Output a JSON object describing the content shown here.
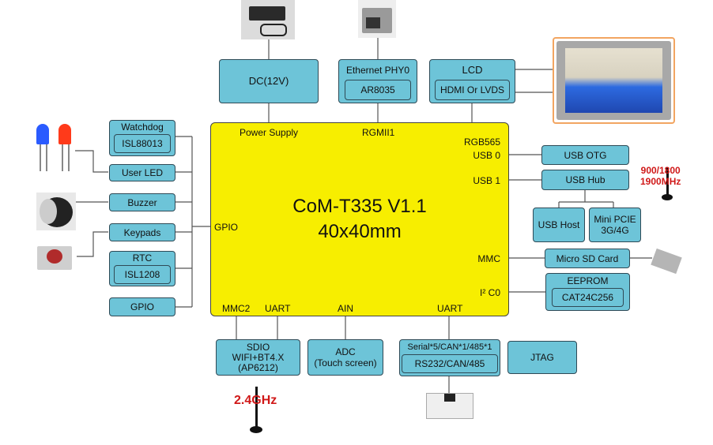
{
  "cpu": {
    "title": "CoM-T335 V1.1",
    "size": "40x40mm",
    "pins": {
      "power_supply": "Power Supply",
      "rgmii1": "RGMII1",
      "rgb565": "RGB565",
      "usb0": "USB 0",
      "usb1": "USB 1",
      "gpio": "GPIO",
      "mmc": "MMC",
      "i2c0": "I² C0",
      "mmc2": "MMC2",
      "uart_left": "UART",
      "ain": "AIN",
      "uart_right": "UART"
    }
  },
  "top": {
    "dc": "DC(12V)",
    "ethernet": {
      "title": "Ethernet PHY0",
      "chip": "AR8035"
    },
    "lcd": {
      "title": "LCD",
      "iface": "HDMI Or LVDS"
    }
  },
  "left": {
    "watchdog": {
      "title": "Watchdog",
      "chip": "ISL88013"
    },
    "user_led": "User LED",
    "buzzer": "Buzzer",
    "keypads": "Keypads",
    "rtc": {
      "title": "RTC",
      "chip": "ISL1208"
    },
    "gpio": "GPIO"
  },
  "right": {
    "usb_otg": "USB OTG",
    "usb_hub": "USB Hub",
    "usb_host": "USB Host",
    "mini_pcie": {
      "line1": "Mini PCIE",
      "line2": "3G/4G"
    },
    "micro_sd": "Micro SD Card",
    "eeprom": {
      "title": "EEPROM",
      "chip": "CAT24C256"
    },
    "cell_band": {
      "line1": "900/1800",
      "line2": "1900MHz"
    }
  },
  "bottom": {
    "wifi": {
      "line1": "SDIO",
      "line2": "WIFI+BT4.X",
      "line3": "(AP6212)"
    },
    "adc": {
      "line1": "ADC",
      "line2": "(Touch screen)"
    },
    "serial": {
      "title": "Serial*5/CAN*1/485*1",
      "iface": "RS232/CAN/485"
    },
    "jtag": "JTAG",
    "wifi_band": "2.4GHz"
  },
  "colors": {
    "module": "#6dc4d8",
    "cpu": "#f7ee00",
    "band_label": "#d01818"
  }
}
